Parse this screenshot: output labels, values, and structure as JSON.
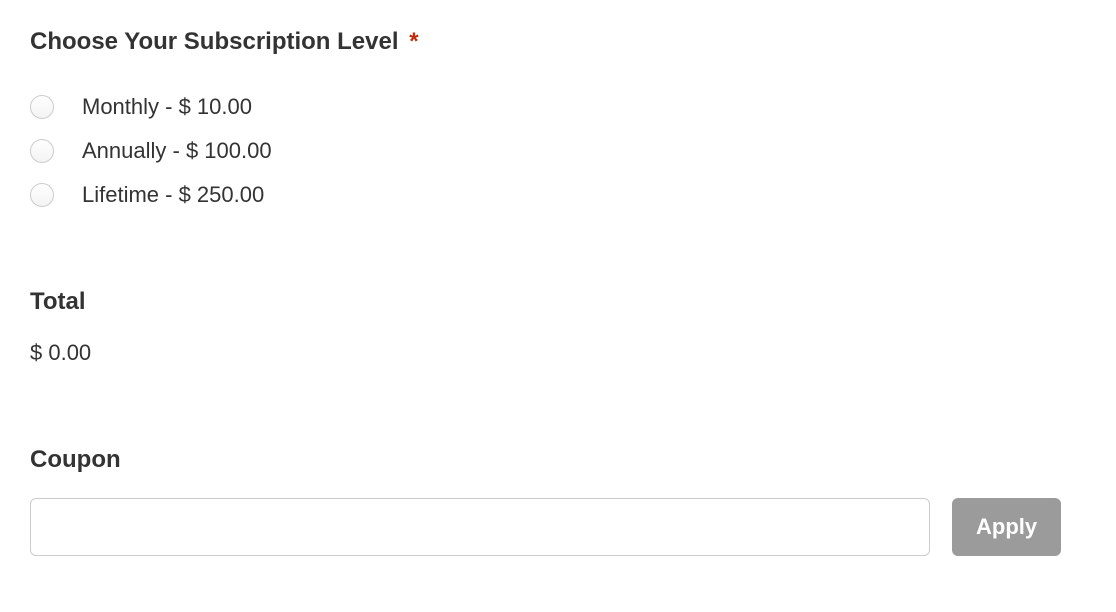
{
  "subscription": {
    "label": "Choose Your Subscription Level",
    "required_mark": "*",
    "options": [
      {
        "label": "Monthly - $ 10.00"
      },
      {
        "label": "Annually - $ 100.00"
      },
      {
        "label": "Lifetime - $ 250.00"
      }
    ]
  },
  "total": {
    "label": "Total",
    "value": "$ 0.00"
  },
  "coupon": {
    "label": "Coupon",
    "input_value": "",
    "apply_label": "Apply"
  }
}
